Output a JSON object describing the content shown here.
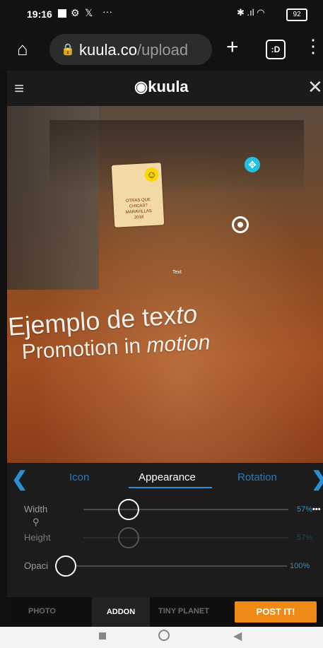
{
  "status_bar": {
    "time": "19:16",
    "icons_left": [
      "notification-square-icon",
      "settings-icon",
      "x-icon"
    ],
    "overflow": "···",
    "icons_right": [
      "bluetooth-icon",
      "signal-icon",
      "wifi-icon"
    ],
    "battery": "92"
  },
  "browser": {
    "url_domain": "kuula.co",
    "url_path": "/upload",
    "tab_count": ":D",
    "menu_glyph": "⋮"
  },
  "app": {
    "logo": "kuula"
  },
  "scene": {
    "hotspot_text": "Text",
    "board_text": "OTRAS QUE CHICAS? MARAVILLAS 2018",
    "text_line1_normal": "Ejemplo de tex",
    "text_line1_italic": "to",
    "text_line2_normal": "Promotion in ",
    "text_line2_italic": "motion"
  },
  "tabs": {
    "items": [
      "Icon",
      "Appearance",
      "Rotation"
    ],
    "active": "Appearance"
  },
  "sliders": {
    "width_label": "Width",
    "width_value": "57%",
    "width_level": 0.57,
    "height_label": "Height",
    "height_value": "57%",
    "height_level": 0.57,
    "opacity_label": "Opaci",
    "opacity_value": "100%",
    "opacity_level": 1.0
  },
  "bottom_bar": {
    "photo": "PHOTO",
    "addon": "ADDON",
    "tiny_planet": "TINY PLANET",
    "post": "POST IT!"
  },
  "colors": {
    "accent": "#2a8fd6",
    "post_button": "#f08a16",
    "hotspot": "#22c1e0"
  }
}
